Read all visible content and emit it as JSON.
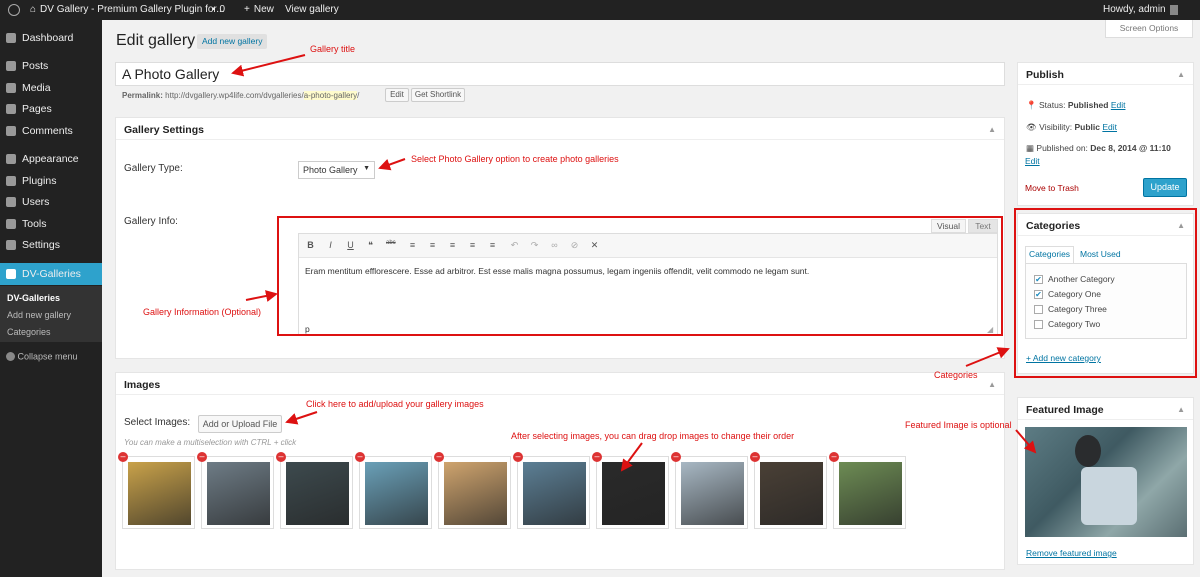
{
  "adminbar": {
    "site_title": "DV Gallery - Premium Gallery Plugin for...",
    "comments_count": "0",
    "new_label": "New",
    "view_label": "View gallery",
    "greeting": "Howdy, admin"
  },
  "sidebar": {
    "items": [
      {
        "label": "Dashboard"
      },
      {
        "label": "Posts"
      },
      {
        "label": "Media"
      },
      {
        "label": "Pages"
      },
      {
        "label": "Comments"
      },
      {
        "label": "Appearance"
      },
      {
        "label": "Plugins"
      },
      {
        "label": "Users"
      },
      {
        "label": "Tools"
      },
      {
        "label": "Settings"
      },
      {
        "label": "DV-Galleries"
      }
    ],
    "submenu": [
      "DV-Galleries",
      "Add new gallery",
      "Categories"
    ],
    "collapse": "Collapse menu"
  },
  "header": {
    "title": "Edit gallery",
    "add_new": "Add new gallery",
    "screen_options": "Screen Options"
  },
  "post": {
    "title": "A Photo Gallery",
    "permalink_label": "Permalink:",
    "permalink_base": "http://dvgallery.wp4life.com/dvgalleries/",
    "permalink_slug": "a-photo-gallery",
    "permalink_end": "/",
    "edit_btn": "Edit",
    "shortlink_btn": "Get Shortlink"
  },
  "settings": {
    "heading": "Gallery Settings",
    "type_label": "Gallery Type:",
    "type_value": "Photo Gallery",
    "info_label": "Gallery Info:",
    "tab_visual": "Visual",
    "tab_text": "Text",
    "content": "Eram mentitum efflorescere. Esse ad arbitror. Est esse malis magna possumus, legam ingeniis offendit, velit commodo ne legam sunt.",
    "path": "p"
  },
  "images": {
    "heading": "Images",
    "select_label": "Select Images:",
    "upload_btn": "Add or Upload File",
    "hint": "You can make a multiselection with CTRL + click",
    "thumb_colors": [
      "#c9a24a",
      "#6e7c86",
      "#3d4a4e",
      "#6aa0b8",
      "#cfa46e",
      "#5c7f95",
      "#2a2a2a",
      "#a8b8c4",
      "#4a4036",
      "#6d8c54"
    ]
  },
  "publish": {
    "heading": "Publish",
    "status_label": "Status:",
    "status_value": "Published",
    "visibility_label": "Visibility:",
    "visibility_value": "Public",
    "published_label": "Published on:",
    "published_value": "Dec 8, 2014 @ 11:10",
    "edit": "Edit",
    "trash": "Move to Trash",
    "update": "Update"
  },
  "categories": {
    "heading": "Categories",
    "tab_all": "Categories",
    "tab_used": "Most Used",
    "items": [
      {
        "label": "Another Category",
        "checked": true
      },
      {
        "label": "Category One",
        "checked": true
      },
      {
        "label": "Category Three",
        "checked": false
      },
      {
        "label": "Category Two",
        "checked": false
      }
    ],
    "add_new": "+ Add new category"
  },
  "featured": {
    "heading": "Featured Image",
    "remove": "Remove featured image"
  },
  "annotations": {
    "title": "Gallery title",
    "type": "Select Photo Gallery option to create photo galleries",
    "info": "Gallery Information (Optional)",
    "upload": "Click here to add/upload your gallery images",
    "drag": "After selecting images, you can drag drop images to change their order",
    "categories": "Categories",
    "featured": "Featured Image is optional"
  },
  "colors": {
    "accent": "#2ea2cc",
    "annotation": "#dd1111",
    "adminbar": "#222222"
  }
}
